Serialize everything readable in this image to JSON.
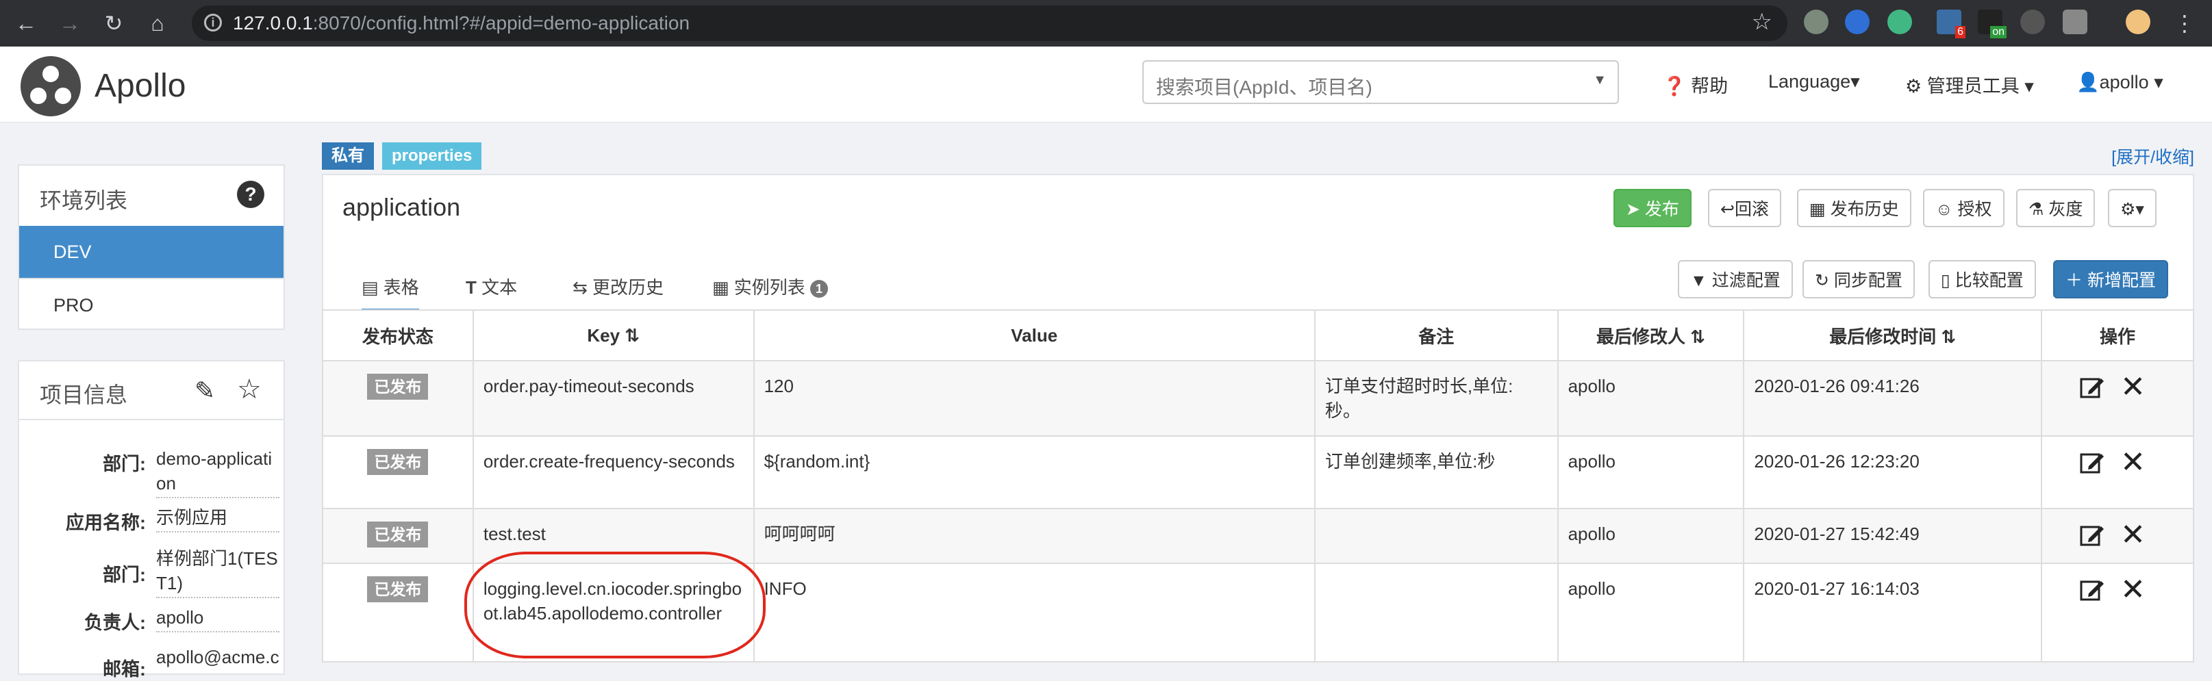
{
  "browser": {
    "url_host": "127.0.0.1",
    "url_rest": ":8070/config.html?#/appid=demo-application",
    "ext_badge_6": "6",
    "ext_badge_on": "on"
  },
  "header": {
    "logo": "Apollo",
    "search_placeholder": "搜索项目(AppId、项目名)",
    "help": "帮助",
    "language": "Language",
    "admin_tools": "管理员工具",
    "user": "apollo"
  },
  "tags": {
    "private": "私有",
    "format": "properties"
  },
  "expand_link": "[展开/收缩]",
  "env_panel": {
    "title": "环境列表",
    "envs": [
      "DEV",
      "PRO"
    ],
    "active": "DEV"
  },
  "project_panel": {
    "title": "项目信息",
    "rows": [
      {
        "label": "部门:",
        "value": "demo-application"
      },
      {
        "label": "应用名称:",
        "value": "示例应用"
      },
      {
        "label": "部门:",
        "value": "样例部门1(TEST1)"
      },
      {
        "label": "负责人:",
        "value": "apollo"
      },
      {
        "label": "邮箱:",
        "value": "apollo@acme.c"
      }
    ]
  },
  "namespace": {
    "title": "application",
    "buttons": {
      "publish": "发布",
      "rollback": "回滚",
      "history": "发布历史",
      "auth": "授权",
      "gray": "灰度"
    },
    "tabs": [
      "表格",
      "文本",
      "更改历史",
      "实例列表"
    ],
    "instance_count": "1",
    "actions": {
      "filter": "过滤配置",
      "sync": "同步配置",
      "compare": "比较配置",
      "add": "新增配置"
    }
  },
  "table": {
    "headers": [
      "发布状态",
      "Key",
      "Value",
      "备注",
      "最后修改人",
      "最后修改时间",
      "操作"
    ],
    "rows": [
      {
        "status": "已发布",
        "key": "order.pay-timeout-seconds",
        "value": "120",
        "comment": "订单支付超时时长,单位:秒。",
        "modifier": "apollo",
        "time": "2020-01-26 09:41:26"
      },
      {
        "status": "已发布",
        "key": "order.create-frequency-seconds",
        "value": "${random.int}",
        "comment": "订单创建频率,单位:秒",
        "modifier": "apollo",
        "time": "2020-01-26 12:23:20"
      },
      {
        "status": "已发布",
        "key": "test.test",
        "value": "呵呵呵呵",
        "comment": "",
        "modifier": "apollo",
        "time": "2020-01-27 15:42:49"
      },
      {
        "status": "已发布",
        "key": "logging.level.cn.iocoder.springboot.lab45.apollodemo.controller",
        "value": "INFO",
        "comment": "",
        "modifier": "apollo",
        "time": "2020-01-27 16:14:03"
      }
    ]
  },
  "colors": {
    "accent": "#428bca",
    "publish": "#5cb85c",
    "add": "#337ab7",
    "annotation": "#e0281c"
  }
}
